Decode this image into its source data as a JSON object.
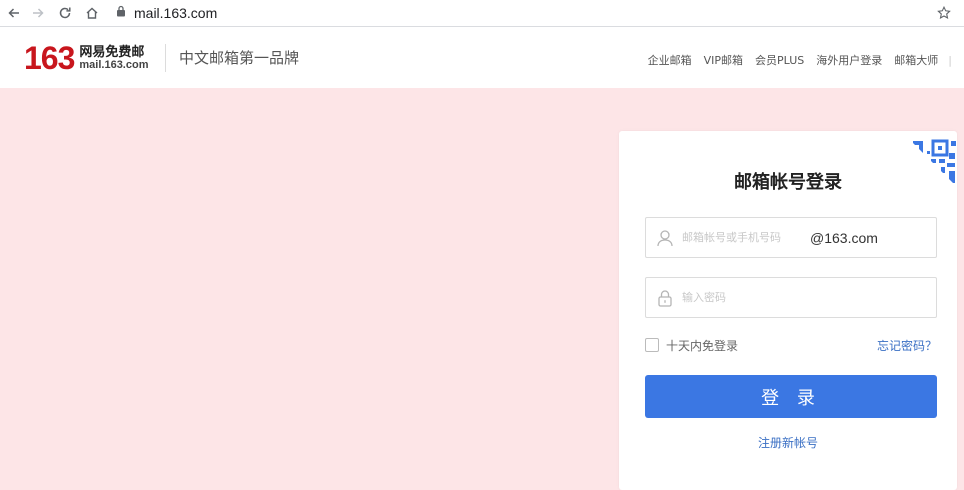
{
  "browser": {
    "url": "mail.163.com",
    "icons": {
      "back": "arrow-left-icon",
      "forward": "arrow-right-icon",
      "reload": "reload-icon",
      "home": "home-icon",
      "secure": "lock-icon",
      "bookmark": "star-icon"
    }
  },
  "header": {
    "logo_number": "163",
    "logo_cn": "网易免费邮",
    "logo_en": "mail.163.com",
    "slogan": "中文邮箱第一品牌",
    "links": [
      "企业邮箱",
      "VIP邮箱",
      "会员PLUS",
      "海外用户登录",
      "邮箱大师"
    ],
    "separator": "|"
  },
  "login": {
    "title": "邮箱帐号登录",
    "account_placeholder": "邮箱帐号或手机号码",
    "account_value": "",
    "domain_suffix": "@163.com",
    "password_placeholder": "输入密码",
    "password_value": "",
    "remember_label": "十天内免登录",
    "remember_checked": false,
    "forgot_label": "忘记密码？",
    "submit_label": "登 录",
    "register_label": "注册新帐号"
  },
  "colors": {
    "brand_red": "#c8161d",
    "banner_pink": "#fde5e7",
    "primary_blue": "#3b77e3",
    "link_blue": "#3a6fc4"
  }
}
